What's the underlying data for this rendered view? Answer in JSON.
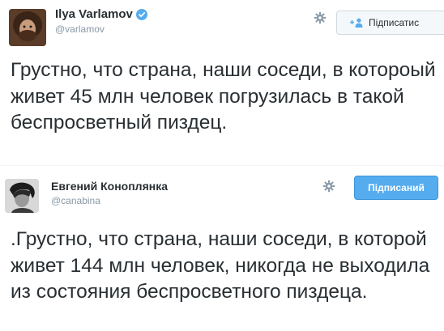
{
  "tweets": [
    {
      "display_name": "Ilya Varlamov",
      "handle": "@varlamov",
      "verified": true,
      "follow_label": "Підписатис",
      "follow_state": "not-following",
      "text": "Грустно, что страна, наши соседи, в котороый живет 45 млн человек погрузилась в такой беспросветный пиздец."
    },
    {
      "display_name": "Евгений Коноплянка",
      "handle": "@canabina",
      "verified": false,
      "follow_label": "Підписаний",
      "follow_state": "following",
      "text": ".Грустно, что страна, наши соседи, в которой живет 144 млн человек, никогда не выходила из состояния беспросветного пиздеца."
    }
  ],
  "icons": {
    "settings": "gear-icon",
    "verified": "verified-badge-icon",
    "follow": "add-person-icon"
  },
  "colors": {
    "accent": "#55acee",
    "text": "#292f33",
    "secondary": "#8899a6"
  }
}
